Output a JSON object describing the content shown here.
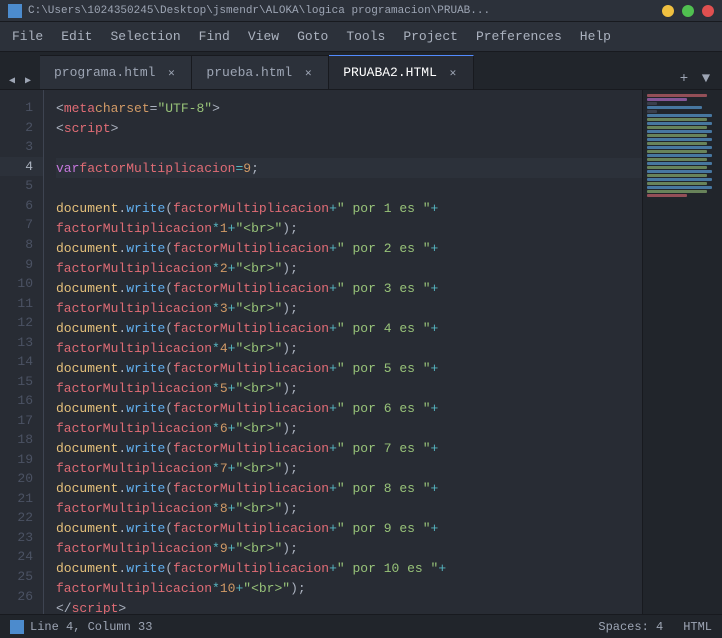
{
  "titlebar": {
    "path": "C:\\Users\\1024350245\\Desktop\\jsmendr\\ALOKA\\logica programacion\\PRUAB...",
    "min_label": "─",
    "max_label": "□",
    "close_label": "✕"
  },
  "menu": {
    "items": [
      "File",
      "Edit",
      "Selection",
      "Find",
      "View",
      "Goto",
      "Tools",
      "Project",
      "Preferences",
      "Help"
    ]
  },
  "tabs": [
    {
      "id": "tab1",
      "label": "programa.html",
      "active": false
    },
    {
      "id": "tab2",
      "label": "prueba.html",
      "active": false
    },
    {
      "id": "tab3",
      "label": "PRUABA2.HTML",
      "active": true
    }
  ],
  "editor": {
    "lines": [
      {
        "num": 1,
        "content_html": "    <span class='plain'>&lt;</span><span class='tag'>meta</span> <span class='attr'>charset</span>=<span class='string'>\"UTF-8\"</span><span class='plain'>&gt;</span>",
        "highlighted": false
      },
      {
        "num": 2,
        "content_html": "    <span class='plain'>&lt;</span><span class='tag'>script</span><span class='plain'>&gt;</span>",
        "highlighted": false
      },
      {
        "num": 3,
        "content_html": "",
        "highlighted": false
      },
      {
        "num": 4,
        "content_html": "        <span class='keyword'>var</span> <span class='variable'>factorMultiplicacion</span> <span class='operator'>=</span> <span class='number'>9</span> <span class='plain'>;</span>",
        "highlighted": true
      },
      {
        "num": 5,
        "content_html": "",
        "highlighted": false
      },
      {
        "num": 6,
        "content_html": "        <span class='object'>document</span><span class='plain'>.</span><span class='method'>write</span><span class='plain'>(</span><span class='variable'>factorMultiplicacion</span><span class='operator'>+</span> <span class='string'>\" por 1 es \"</span> <span class='operator'>+</span>",
        "highlighted": false
      },
      {
        "num": 7,
        "content_html": "                <span class='variable'>factorMultiplicacion</span> <span class='operator'>*</span> <span class='number'>1</span> <span class='operator'>+</span> <span class='string'>\"&lt;br&gt;\"</span><span class='plain'>);</span>",
        "highlighted": false
      },
      {
        "num": 8,
        "content_html": "        <span class='object'>document</span><span class='plain'>.</span><span class='method'>write</span><span class='plain'>(</span><span class='variable'>factorMultiplicacion</span><span class='operator'>+</span><span class='string'>\" por 2 es \"</span> <span class='operator'>+</span>",
        "highlighted": false
      },
      {
        "num": 9,
        "content_html": "                <span class='variable'>factorMultiplicacion</span> <span class='operator'>*</span> <span class='number'>2</span> <span class='operator'>+</span> <span class='string'>\"&lt;br&gt;\"</span><span class='plain'>);</span>",
        "highlighted": false
      },
      {
        "num": 10,
        "content_html": "        <span class='object'>document</span><span class='plain'>.</span><span class='method'>write</span><span class='plain'>(</span><span class='variable'>factorMultiplicacion</span><span class='operator'>+</span><span class='string'>\" por 3 es \"</span> <span class='operator'>+</span>",
        "highlighted": false
      },
      {
        "num": 11,
        "content_html": "                <span class='variable'>factorMultiplicacion</span> <span class='operator'>*</span> <span class='number'>3</span> <span class='operator'>+</span> <span class='string'>\"&lt;br&gt;\"</span><span class='plain'>);</span>",
        "highlighted": false
      },
      {
        "num": 12,
        "content_html": "        <span class='object'>document</span><span class='plain'>.</span><span class='method'>write</span><span class='plain'>(</span><span class='variable'>factorMultiplicacion</span><span class='operator'>+</span><span class='string'>\" por 4 es \"</span> <span class='operator'>+</span>",
        "highlighted": false
      },
      {
        "num": 13,
        "content_html": "                <span class='variable'>factorMultiplicacion</span> <span class='operator'>*</span> <span class='number'>4</span> <span class='operator'>+</span> <span class='string'>\"&lt;br&gt;\"</span><span class='plain'>);</span>",
        "highlighted": false
      },
      {
        "num": 14,
        "content_html": "        <span class='object'>document</span><span class='plain'>.</span><span class='method'>write</span><span class='plain'>(</span><span class='variable'>factorMultiplicacion</span><span class='operator'>+</span><span class='string'>\" por 5 es \"</span> <span class='operator'>+</span>",
        "highlighted": false
      },
      {
        "num": 15,
        "content_html": "                <span class='variable'>factorMultiplicacion</span> <span class='operator'>*</span> <span class='number'>5</span> <span class='operator'>+</span> <span class='string'>\"&lt;br&gt;\"</span><span class='plain'>);</span>",
        "highlighted": false
      },
      {
        "num": 16,
        "content_html": "        <span class='object'>document</span><span class='plain'>.</span><span class='method'>write</span><span class='plain'>(</span><span class='variable'>factorMultiplicacion</span><span class='operator'>+</span><span class='string'>\" por 6 es \"</span> <span class='operator'>+</span>",
        "highlighted": false
      },
      {
        "num": 17,
        "content_html": "                <span class='variable'>factorMultiplicacion</span> <span class='operator'>*</span> <span class='number'>6</span> <span class='operator'>+</span> <span class='string'>\"&lt;br&gt;\"</span><span class='plain'>);</span>",
        "highlighted": false
      },
      {
        "num": 18,
        "content_html": "        <span class='object'>document</span><span class='plain'>.</span><span class='method'>write</span><span class='plain'>(</span><span class='variable'>factorMultiplicacion</span><span class='operator'>+</span><span class='string'>\" por 7 es \"</span> <span class='operator'>+</span>",
        "highlighted": false
      },
      {
        "num": 19,
        "content_html": "                <span class='variable'>factorMultiplicacion</span> <span class='operator'>*</span> <span class='number'>7</span> <span class='operator'>+</span> <span class='string'>\"&lt;br&gt;\"</span><span class='plain'>);</span>",
        "highlighted": false
      },
      {
        "num": 20,
        "content_html": "        <span class='object'>document</span><span class='plain'>.</span><span class='method'>write</span><span class='plain'>(</span><span class='variable'>factorMultiplicacion</span><span class='operator'>+</span><span class='string'>\" por 8 es \"</span> <span class='operator'>+</span>",
        "highlighted": false
      },
      {
        "num": 21,
        "content_html": "                <span class='variable'>factorMultiplicacion</span> <span class='operator'>*</span> <span class='number'>8</span> <span class='operator'>+</span> <span class='string'>\"&lt;br&gt;\"</span><span class='plain'>);</span>",
        "highlighted": false
      },
      {
        "num": 22,
        "content_html": "        <span class='object'>document</span><span class='plain'>.</span><span class='method'>write</span><span class='plain'>(</span><span class='variable'>factorMultiplicacion</span><span class='operator'>+</span><span class='string'>\" por 9 es \"</span> <span class='operator'>+</span>",
        "highlighted": false
      },
      {
        "num": 23,
        "content_html": "                <span class='variable'>factorMultiplicacion</span> <span class='operator'>*</span> <span class='number'>9</span> <span class='operator'>+</span> <span class='string'>\"&lt;br&gt;\"</span><span class='plain'>);</span>",
        "highlighted": false
      },
      {
        "num": 24,
        "content_html": "        <span class='object'>document</span><span class='plain'>.</span><span class='method'>write</span><span class='plain'>(</span><span class='variable'>factorMultiplicacion</span><span class='operator'>+</span><span class='string'>\" por 10 es \"</span> <span class='operator'>+</span>",
        "highlighted": false
      },
      {
        "num": 25,
        "content_html": "                <span class='variable'>factorMultiplicacion</span> <span class='operator'>*</span> <span class='number'>10</span> <span class='operator'>+</span> <span class='string'>\"&lt;br&gt;\"</span><span class='plain'>);</span>",
        "highlighted": false
      },
      {
        "num": 26,
        "content_html": "    <span class='plain'>&lt;/</span><span class='tag'>script</span><span class='plain'>&gt;</span>",
        "highlighted": false
      }
    ]
  },
  "statusbar": {
    "position": "Line 4, Column 33",
    "spaces": "Spaces: 4",
    "language": "HTML"
  }
}
